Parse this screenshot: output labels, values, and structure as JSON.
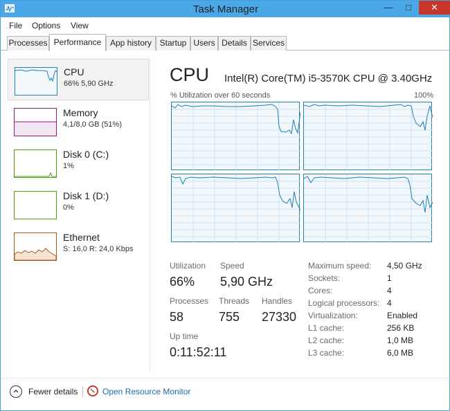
{
  "window": {
    "title": "Task Manager",
    "minimize_glyph": "—",
    "maximize_glyph": "□",
    "close_glyph": "✕",
    "accent": "#4aa8e8",
    "close_color": "#c7352b"
  },
  "menu": {
    "file": "File",
    "options": "Options",
    "view": "View"
  },
  "tabs": [
    "Processes",
    "Performance",
    "App history",
    "Startup",
    "Users",
    "Details",
    "Services"
  ],
  "active_tab": "Performance",
  "sidebar": [
    {
      "title": "CPU",
      "sub": "66% 5,90 GHz",
      "color": "#1f7fb5",
      "selected": true
    },
    {
      "title": "Memory",
      "sub": "4,1/8,0 GB (51%)",
      "color": "#8b1a8b"
    },
    {
      "title": "Disk 0 (C:)",
      "sub": "1%",
      "color": "#4d9a0e"
    },
    {
      "title": "Disk 1 (D:)",
      "sub": "0%",
      "color": "#4d9a0e"
    },
    {
      "title": "Ethernet",
      "sub": "S: 16,0  R: 24,0 Kbps",
      "color": "#a7561a"
    }
  ],
  "main": {
    "title": "CPU",
    "cpu_name": "Intel(R) Core(TM) i5-3570K CPU @ 3.40GHz",
    "graph_label": "% Utilization over 60 seconds",
    "graph_max": "100%",
    "stats": {
      "utilization_label": "Utilization",
      "utilization": "66%",
      "speed_label": "Speed",
      "speed": "5,90 GHz",
      "processes_label": "Processes",
      "processes": "58",
      "threads_label": "Threads",
      "threads": "755",
      "handles_label": "Handles",
      "handles": "27330",
      "uptime_label": "Up time",
      "uptime": "0:11:52:11"
    },
    "properties": [
      {
        "label": "Maximum speed:",
        "value": "4,50 GHz"
      },
      {
        "label": "Sockets:",
        "value": "1"
      },
      {
        "label": "Cores:",
        "value": "4"
      },
      {
        "label": "Logical processors:",
        "value": "4"
      },
      {
        "label": "Virtualization:",
        "value": "Enabled"
      },
      {
        "label": "L1 cache:",
        "value": "256 KB"
      },
      {
        "label": "L2 cache:",
        "value": "1,0 MB"
      },
      {
        "label": "L3 cache:",
        "value": "6,0 MB"
      }
    ]
  },
  "footer": {
    "fewer_details": "Fewer details",
    "open_monitor": "Open Resource Monitor"
  }
}
